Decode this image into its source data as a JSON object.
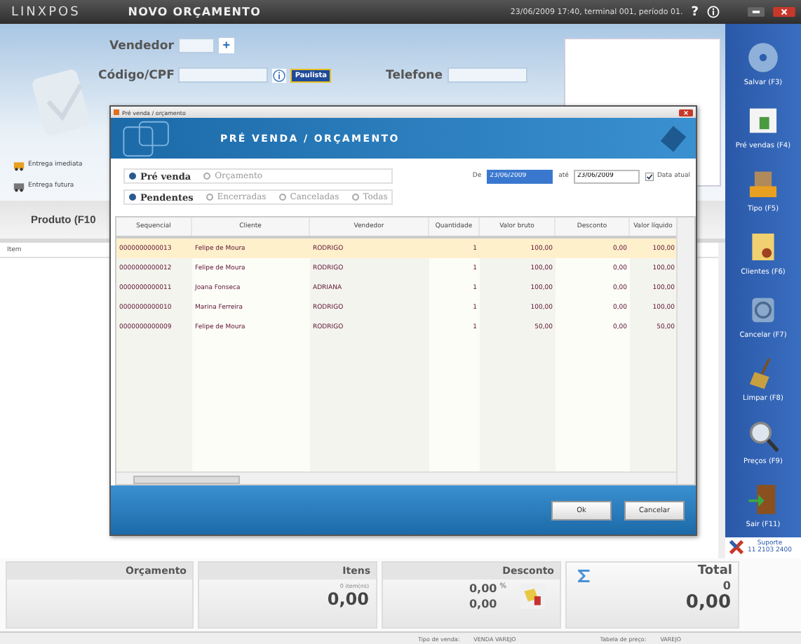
{
  "top_bar": {
    "logo": "LINXPOS",
    "title": "NOVO ORÇAMENTO",
    "status": "23/06/2009 17:40, terminal 001, período 01.",
    "help": "?"
  },
  "form": {
    "vendedor_label": "Vendedor",
    "vendedor_add": "+",
    "codigo_label": "Código/CPF",
    "nfp_logo": "Paulista",
    "telefone_label": "Telefone"
  },
  "delivery": [
    {
      "label": "Entrega imediata"
    },
    {
      "label": "Entrega futura"
    }
  ],
  "product": {
    "label": "Produto (F10",
    "column": "Item"
  },
  "sidebar": [
    {
      "label": "Salvar (F3)"
    },
    {
      "label": "Pré vendas (F4)"
    },
    {
      "label": "Tipo (F5)"
    },
    {
      "label": "Clientes (F6)"
    },
    {
      "label": "Cancelar (F7)"
    },
    {
      "label": "Limpar (F8)"
    },
    {
      "label": "Preços (F9)"
    },
    {
      "label": "Sair (F11)"
    }
  ],
  "support": {
    "label": "Suporte",
    "phone": "11 2103 2400"
  },
  "summary": {
    "orcamento": {
      "title": "Orçamento"
    },
    "itens": {
      "title": "Itens",
      "count": "0 item(ns)",
      "value": "0,00"
    },
    "desconto": {
      "title": "Desconto",
      "percent": "0,00",
      "percent_sign": "%",
      "value": "0,00"
    },
    "total": {
      "title": "Total",
      "count": "0",
      "value": "0,00"
    }
  },
  "status_bar": {
    "tipo_label": "Tipo de venda:",
    "tipo": "VENDA VAREJO",
    "tabela_label": "Tabela de preço:",
    "tabela": "VAREJO"
  },
  "dialog": {
    "title": "Pré venda / orçamento",
    "header": "PRÉ VENDA / ORÇAMENTO",
    "types": [
      {
        "label": "Pré venda",
        "selected": true
      },
      {
        "label": "Orçamento",
        "selected": false
      }
    ],
    "statuses": [
      {
        "label": "Pendentes",
        "selected": true
      },
      {
        "label": "Encerradas",
        "selected": false
      },
      {
        "label": "Canceladas",
        "selected": false
      },
      {
        "label": "Todas",
        "selected": false
      }
    ],
    "from_label": "De",
    "from": "23/06/2009",
    "to_label": "até",
    "to": "23/06/2009",
    "today": {
      "label": "Data atual",
      "checked": true
    },
    "columns": [
      "Sequencial",
      "Cliente",
      "Vendedor",
      "Quantidade",
      "Valor bruto",
      "Desconto",
      "Valor líquido"
    ],
    "rows": [
      {
        "cells": [
          "0000000000013",
          "Felipe de Moura",
          "RODRIGO",
          "1",
          "100,00",
          "0,00",
          "100,00"
        ],
        "selected": true
      },
      {
        "cells": [
          "0000000000012",
          "Felipe de Moura",
          "RODRIGO",
          "1",
          "100,00",
          "0,00",
          "100,00"
        ],
        "selected": false
      },
      {
        "cells": [
          "0000000000011",
          "Joana Fonseca",
          "ADRIANA",
          "1",
          "100,00",
          "0,00",
          "100,00"
        ],
        "selected": false
      },
      {
        "cells": [
          "0000000000010",
          "Marina Ferreira",
          "RODRIGO",
          "1",
          "100,00",
          "0,00",
          "100,00"
        ],
        "selected": false
      },
      {
        "cells": [
          "0000000000009",
          "Felipe de Moura",
          "RODRIGO",
          "1",
          "50,00",
          "0,00",
          "50,00"
        ],
        "selected": false
      }
    ],
    "buttons": [
      "Ok",
      "Cancelar"
    ]
  }
}
